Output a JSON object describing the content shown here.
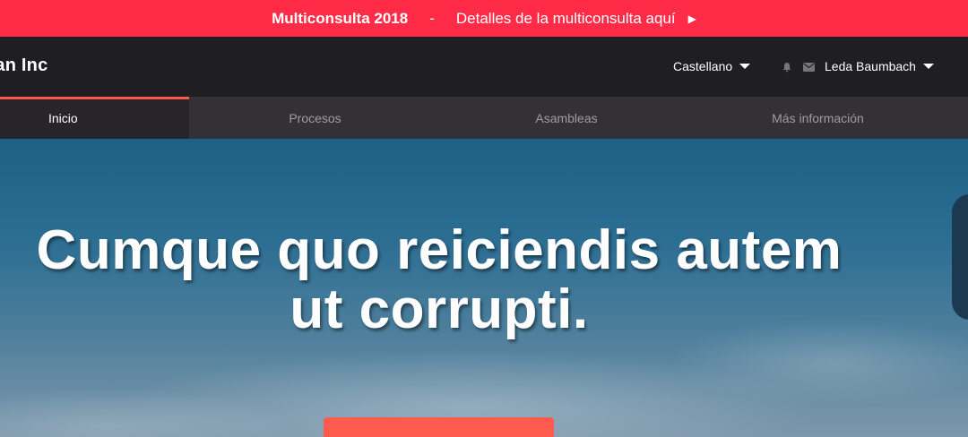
{
  "announcement": {
    "title": "Multiconsulta 2018",
    "separator": "-",
    "link_text": "Detalles de la multiconsulta aquí",
    "arrow": "▶"
  },
  "header": {
    "org_name": "han Inc",
    "language": "Castellano",
    "user_name": "Leda Baumbach"
  },
  "nav": {
    "items": [
      {
        "label": "Inicio",
        "active": true
      },
      {
        "label": "Procesos",
        "active": false
      },
      {
        "label": "Asambleas",
        "active": false
      },
      {
        "label": "Más información",
        "active": false
      }
    ]
  },
  "hero": {
    "headline": "Cumque quo reiciendis autem ut corrupti."
  },
  "icons": [
    "bell-icon",
    "mail-icon",
    "caret-down-icon",
    "play-arrow-icon"
  ],
  "colors": {
    "announcement_bg": "#ff2b47",
    "topbar_bg": "#1f1e22",
    "nav_bg": "#343136",
    "accent": "#ff5a4e"
  }
}
